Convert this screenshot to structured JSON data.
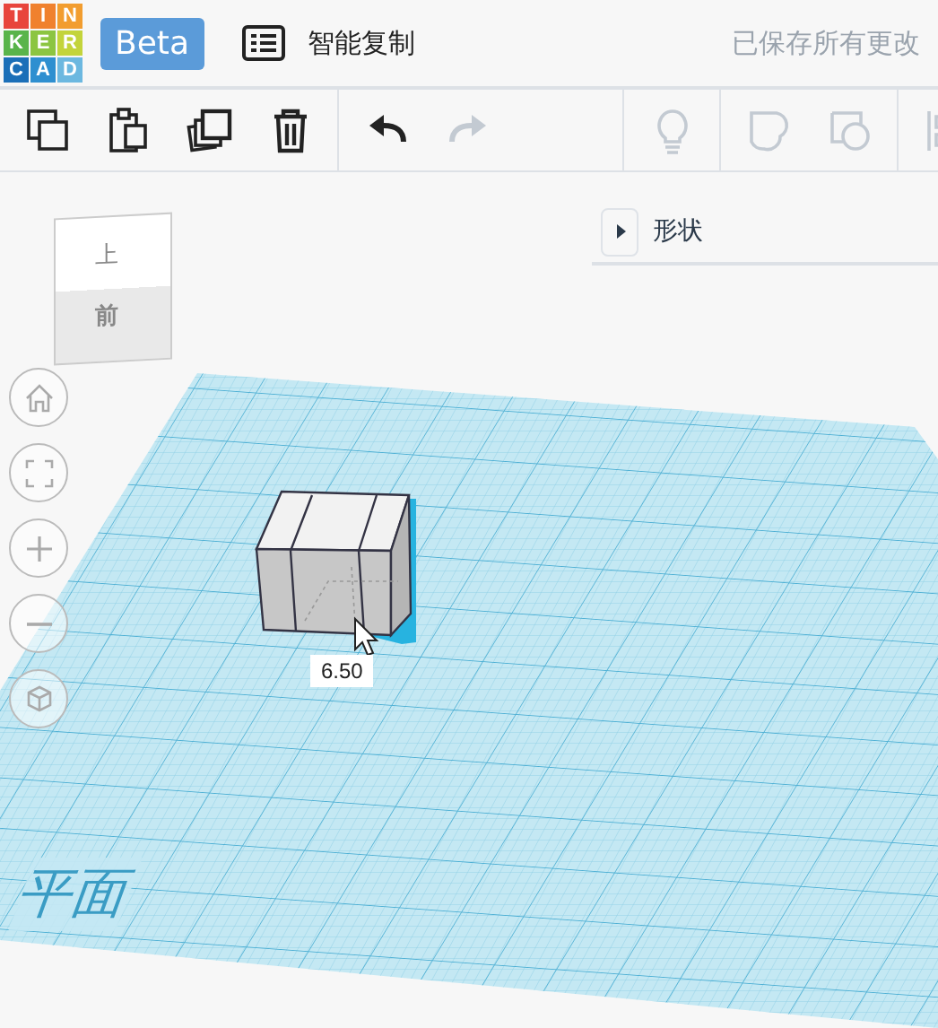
{
  "header": {
    "logo": [
      {
        "letter": "T",
        "color": "#e8453c"
      },
      {
        "letter": "I",
        "color": "#f0812e"
      },
      {
        "letter": "N",
        "color": "#f29d2f"
      },
      {
        "letter": "K",
        "color": "#59b44a"
      },
      {
        "letter": "E",
        "color": "#8cc541"
      },
      {
        "letter": "R",
        "color": "#c3d43b"
      },
      {
        "letter": "C",
        "color": "#1b6fb8"
      },
      {
        "letter": "A",
        "color": "#2e8fd0"
      },
      {
        "letter": "D",
        "color": "#6cb8e0"
      }
    ],
    "badge": "Beta",
    "document_title": "智能复制",
    "save_status": "已保存所有更改"
  },
  "toolbar": {
    "groups": [
      [
        {
          "kind": "copy",
          "disabled": false
        },
        {
          "kind": "paste",
          "disabled": false
        },
        {
          "kind": "duplicate",
          "disabled": false
        },
        {
          "kind": "delete",
          "disabled": false
        }
      ],
      [
        {
          "kind": "undo",
          "disabled": false
        },
        {
          "kind": "redo",
          "disabled": true
        }
      ],
      [
        {
          "kind": "bulb",
          "disabled": true
        }
      ],
      [
        {
          "kind": "shape-union",
          "disabled": true
        },
        {
          "kind": "shape-subtract",
          "disabled": true
        }
      ],
      [
        {
          "kind": "align",
          "disabled": true
        }
      ]
    ]
  },
  "view_cube": {
    "top": "上",
    "front": "前"
  },
  "nav_buttons": [
    {
      "kind": "home"
    },
    {
      "kind": "fit"
    },
    {
      "kind": "zoom-in"
    },
    {
      "kind": "zoom-out"
    },
    {
      "kind": "view"
    }
  ],
  "shapes_panel": {
    "title": "形状",
    "expanded": false
  },
  "workplane": {
    "label": "平面"
  },
  "dimension": {
    "value": "6.50"
  }
}
